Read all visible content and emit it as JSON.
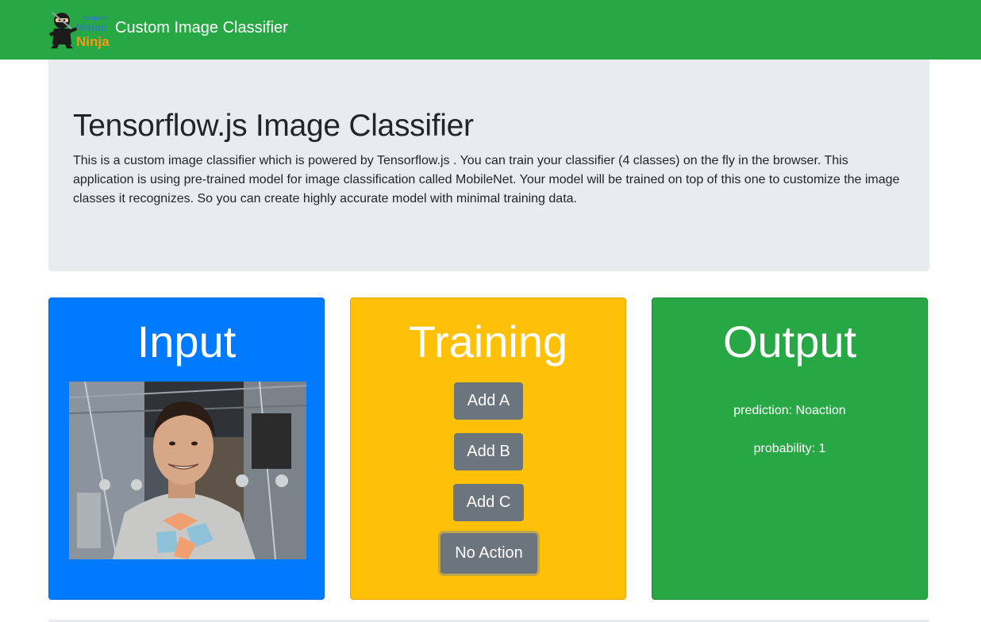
{
  "navbar": {
    "brand_title": "Custom Image Classifier",
    "logo_icon": "computer-vision-ninja-logo",
    "logo_text": [
      "Computer",
      "Vision",
      "Ninja"
    ],
    "background": "#28a745"
  },
  "jumbotron": {
    "title": "Tensorflow.js Image Classifier",
    "description": "This is a custom image classifier which is powered by Tensorflow.js . You can train your classifier (4 classes) on the fly in the browser. This application is using pre-trained model for image classification called MobileNet. Your model will be trained on top of this one to customize the image classes it recognizes. So you can create highly accurate model with minimal training data."
  },
  "cards": {
    "input": {
      "title": "Input",
      "color": "#007bff"
    },
    "training": {
      "title": "Training",
      "color": "#ffc107",
      "buttons": [
        "Add A",
        "Add B",
        "Add C",
        "No Action"
      ]
    },
    "output": {
      "title": "Output",
      "color": "#28a745",
      "prediction": "prediction: Noaction",
      "probability": "probability: 1"
    }
  }
}
